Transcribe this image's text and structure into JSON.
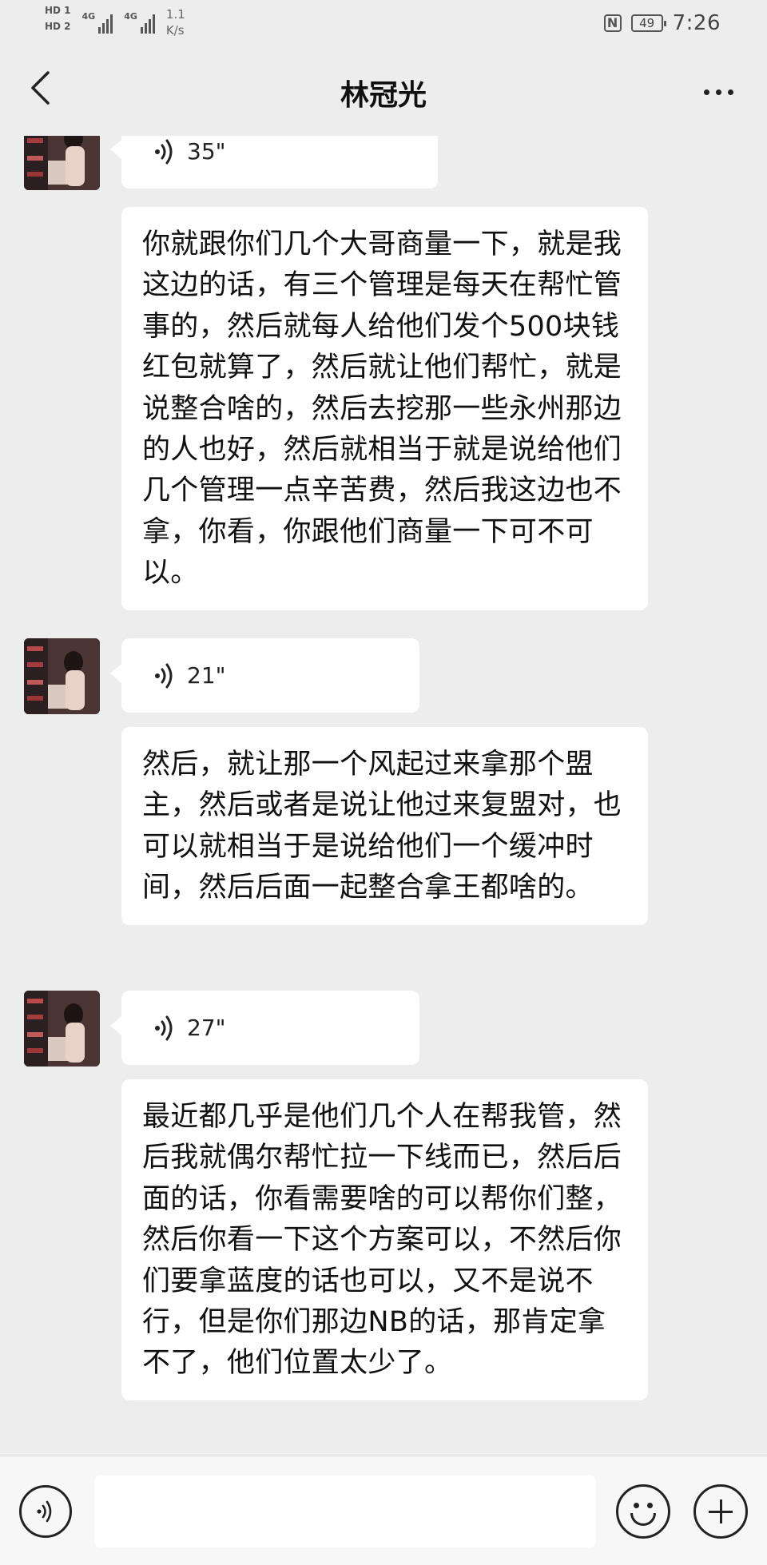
{
  "status_bar": {
    "sim1": "HD 1",
    "sim2": "HD 2",
    "network1": "4G",
    "network2": "4G",
    "speed_value": "1.1",
    "speed_unit": "K/s",
    "nfc_icon": "N",
    "battery_level": "49",
    "time": "7:26"
  },
  "header": {
    "title": "林冠光",
    "back_icon": "chevron-left-icon",
    "more_icon": "more-horizontal-icon"
  },
  "messages": [
    {
      "type": "voice",
      "duration": "35\""
    },
    {
      "type": "text",
      "text": "你就跟你们几个大哥商量一下，就是我这边的话，有三个管理是每天在帮忙管事的，然后就每人给他们发个500块钱红包就算了，然后就让他们帮忙，就是说整合啥的，然后去挖那一些永州那边的人也好，然后就相当于就是说给他们几个管理一点辛苦费，然后我这边也不拿，你看，你跟他们商量一下可不可以。"
    },
    {
      "type": "voice",
      "duration": "21\""
    },
    {
      "type": "text",
      "text": "然后，就让那一个风起过来拿那个盟主，然后或者是说让他过来复盟对，也可以就相当于是说给他们一个缓冲时间，然后后面一起整合拿王都啥的。"
    },
    {
      "type": "voice",
      "duration": "27\""
    },
    {
      "type": "text",
      "text": "最近都几乎是他们几个人在帮我管，然后我就偶尔帮忙拉一下线而已，然后后面的话，你看需要啥的可以帮你们整，然后你看一下这个方案可以，不然后你们要拿蓝度的话也可以，又不是说不行，但是你们那边NB的话，那肯定拿不了，他们位置太少了。"
    }
  ],
  "input_bar": {
    "voice_icon": "voice-mode-icon",
    "input_value": "",
    "emoji_icon": "emoji-smile-icon",
    "plus_icon": "plus-circle-icon"
  }
}
